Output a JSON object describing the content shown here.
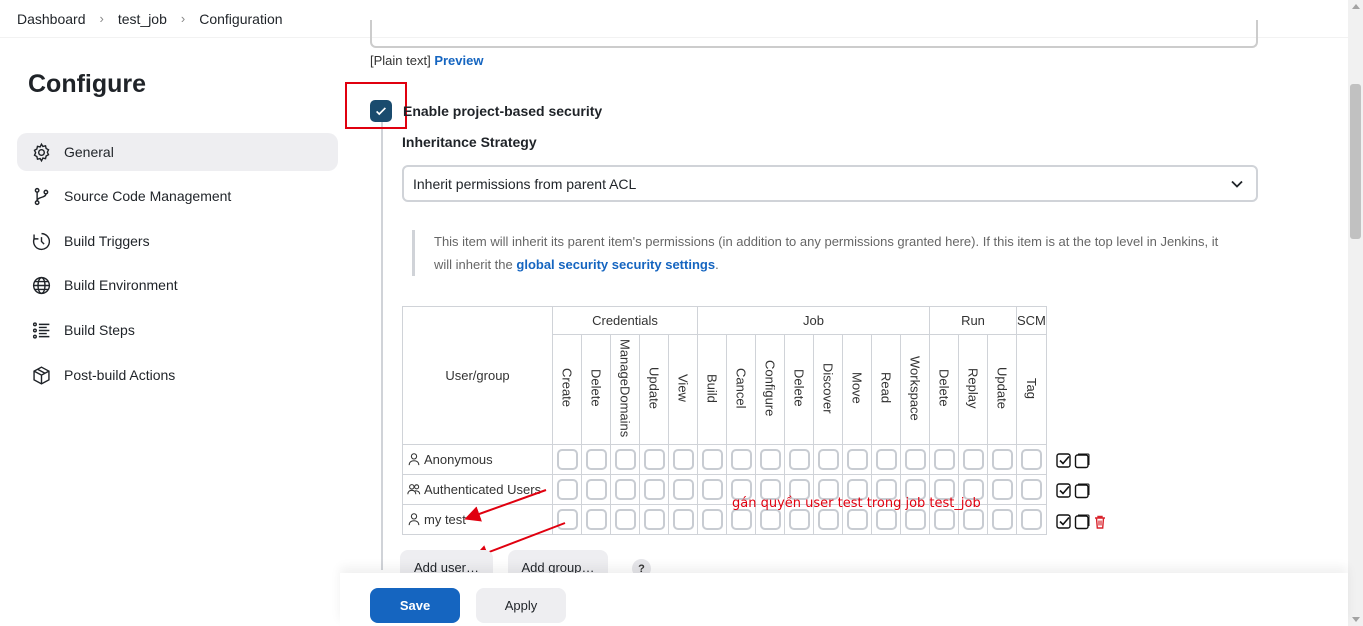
{
  "breadcrumb": [
    "Dashboard",
    "test_job",
    "Configuration"
  ],
  "page_title": "Configure",
  "sidebar": {
    "items": [
      {
        "label": "General",
        "icon": "gear-icon",
        "active": true
      },
      {
        "label": "Source Code Management",
        "icon": "branch-icon"
      },
      {
        "label": "Build Triggers",
        "icon": "clock-icon"
      },
      {
        "label": "Build Environment",
        "icon": "globe-icon"
      },
      {
        "label": "Build Steps",
        "icon": "list-icon"
      },
      {
        "label": "Post-build Actions",
        "icon": "package-icon"
      }
    ]
  },
  "description": {
    "plain_text": "[Plain text]",
    "preview_link": "Preview"
  },
  "security": {
    "enable_label": "Enable project-based security",
    "enabled": true,
    "strategy_label": "Inheritance Strategy",
    "strategy_value": "Inherit permissions from parent ACL",
    "info_text_1": "This item will inherit its parent item's permissions (in addition to any permissions granted here). If this item is at the top level in Jenkins, it will inherit the",
    "info_link": "global security security settings",
    "info_text_2": "."
  },
  "matrix": {
    "user_group_header": "User/group",
    "groups": [
      {
        "name": "Credentials",
        "span": 5
      },
      {
        "name": "Job",
        "span": 8
      },
      {
        "name": "Run",
        "span": 3
      },
      {
        "name": "SCM",
        "span": 1
      }
    ],
    "permissions": [
      "Create",
      "Delete",
      "ManageDomains",
      "Update",
      "View",
      "Build",
      "Cancel",
      "Configure",
      "Delete",
      "Discover",
      "Move",
      "Read",
      "Workspace",
      "Delete",
      "Replay",
      "Update",
      "Tag"
    ],
    "rows": [
      {
        "name": "Anonymous",
        "type": "user",
        "removable": false
      },
      {
        "name": "Authenticated Users",
        "type": "group",
        "removable": false
      },
      {
        "name": "my test",
        "type": "user",
        "removable": true
      }
    ]
  },
  "annotation": "gán quyền user test trong job test_job",
  "buttons": {
    "add_user": "Add user…",
    "add_group": "Add group…",
    "help": "?",
    "save": "Save",
    "apply": "Apply"
  },
  "colors": {
    "accent": "#1565c0",
    "checkbox_checked": "#1a4b6e",
    "annotation_red": "#e0000f"
  }
}
